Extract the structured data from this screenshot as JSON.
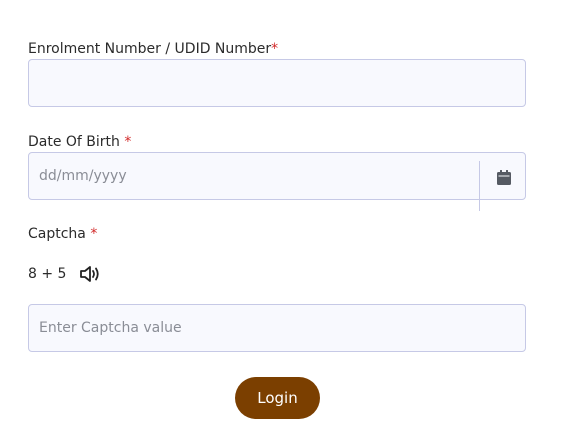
{
  "form": {
    "enrolment": {
      "label": "Enrolment Number / UDID Number",
      "required_mark": "*",
      "value": "",
      "placeholder": ""
    },
    "dob": {
      "label": "Date Of Birth ",
      "required_mark": "*",
      "value": "",
      "placeholder": "dd/mm/yyyy",
      "icon": "calendar-icon"
    },
    "captcha": {
      "label": "Captcha ",
      "required_mark": "*",
      "question": "8 + 5",
      "audio_icon": "speaker-icon",
      "value": "",
      "placeholder": "Enter Captcha value"
    },
    "login_label": "Login"
  },
  "colors": {
    "required": "#d22a2a",
    "field_border": "#c6c9e6",
    "field_bg": "#f8f9fe",
    "button_bg": "#7b3f00",
    "button_text": "#ffffff",
    "icon": "#555a63"
  }
}
